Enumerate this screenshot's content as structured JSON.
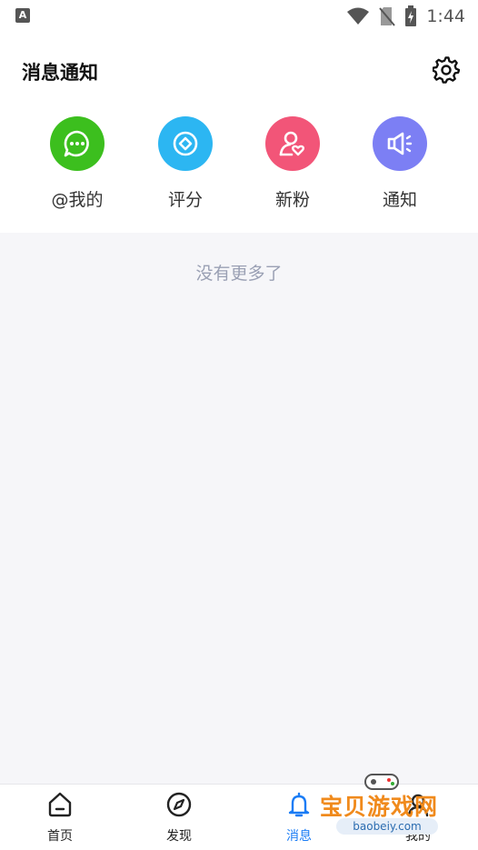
{
  "status_bar": {
    "time": "1:44",
    "sim_label": "A"
  },
  "header": {
    "title": "消息通知"
  },
  "categories": [
    {
      "label": "@我的",
      "icon": "chat-bubble-icon",
      "color": "#3cbf1e"
    },
    {
      "label": "评分",
      "icon": "rating-diamond-icon",
      "color": "#2cb6f2"
    },
    {
      "label": "新粉",
      "icon": "new-follower-icon",
      "color": "#f25578"
    },
    {
      "label": "通知",
      "icon": "megaphone-icon",
      "color": "#7c7ff4"
    }
  ],
  "content": {
    "empty_text": "没有更多了"
  },
  "tabbar": {
    "items": [
      {
        "label": "首页",
        "icon": "home-icon"
      },
      {
        "label": "发现",
        "icon": "compass-icon"
      },
      {
        "label": "消息",
        "icon": "bell-icon",
        "active": true
      },
      {
        "label": "我的",
        "icon": "profile-icon"
      }
    ],
    "active_color": "#1a7cf5"
  },
  "watermark": {
    "text": "宝贝游戏网",
    "url": "baobeiy.com"
  }
}
